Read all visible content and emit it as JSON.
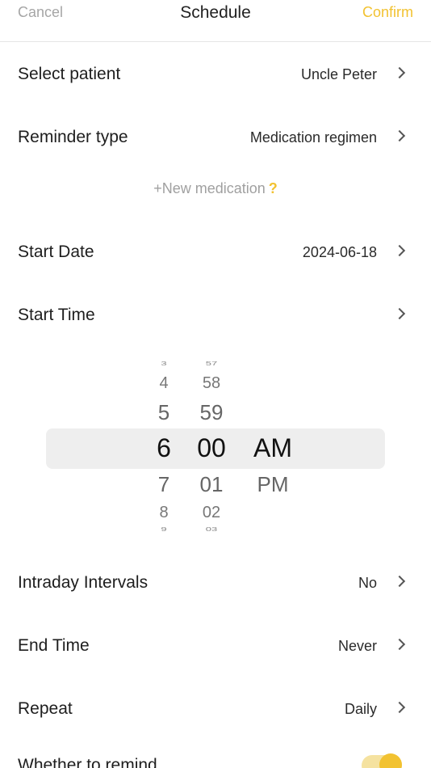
{
  "header": {
    "cancel": "Cancel",
    "title": "Schedule",
    "confirm": "Confirm"
  },
  "rows": {
    "patient": {
      "label": "Select patient",
      "value": "Uncle Peter"
    },
    "reminder_type": {
      "label": "Reminder type",
      "value": "Medication regimen"
    },
    "start_date": {
      "label": "Start Date",
      "value": "2024-06-18"
    },
    "start_time": {
      "label": "Start Time"
    },
    "intraday": {
      "label": "Intraday Intervals",
      "value": "No"
    },
    "end_time": {
      "label": "End Time",
      "value": "Never"
    },
    "repeat": {
      "label": "Repeat",
      "value": "Daily"
    },
    "remind": {
      "label": "Whether to remind",
      "enabled": true
    }
  },
  "new_medication": {
    "text": "+New medication",
    "help": "?"
  },
  "picker": {
    "hours": [
      "3",
      "4",
      "5",
      "6",
      "7",
      "8",
      "9"
    ],
    "minutes": [
      "57",
      "58",
      "59",
      "00",
      "01",
      "02",
      "03"
    ],
    "periods": [
      "AM",
      "PM"
    ],
    "selected": {
      "hour": "6",
      "minute": "00",
      "period": "AM"
    }
  },
  "colors": {
    "accent": "#f2c231",
    "muted": "#a6a6a6",
    "highlight": "#eeeeee"
  },
  "icons": {
    "row_arrow": "chevron-right-icon",
    "toggle": "toggle-switch"
  }
}
